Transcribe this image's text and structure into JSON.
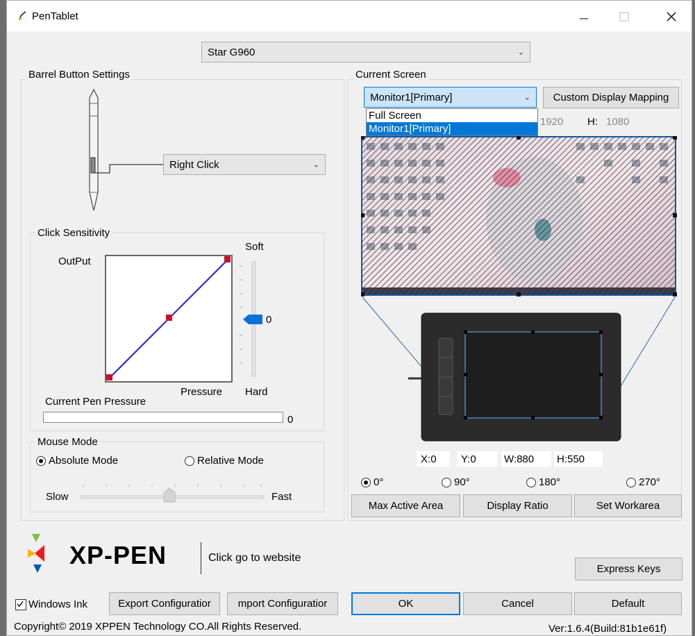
{
  "window": {
    "title": "PenTablet",
    "minimize_icon": "minimize-icon",
    "maximize_icon": "maximize-icon",
    "close_icon": "close-icon"
  },
  "device_select": {
    "value": "Star G960"
  },
  "barrel": {
    "group_label": "Barrel Button Settings",
    "button_action": "Right Click"
  },
  "click_sensitivity": {
    "group_label": "Click Sensitivity",
    "output_label": "OutPut",
    "pressure_label": "Pressure",
    "soft_label": "Soft",
    "hard_label": "Hard",
    "slider_value": "0",
    "current_pen_pressure_label": "Current Pen Pressure",
    "current_pen_pressure_value": "0"
  },
  "mouse_mode": {
    "group_label": "Mouse Mode",
    "absolute_label": "Absolute Mode",
    "relative_label": "Relative Mode",
    "selected": "absolute",
    "slow_label": "Slow",
    "fast_label": "Fast"
  },
  "current_screen": {
    "group_label": "Current Screen",
    "monitor_select": "Monitor1[Primary]",
    "dropdown_options": [
      "Full Screen",
      "Monitor1[Primary]"
    ],
    "custom_mapping_button": "Custom Display Mapping",
    "screen_w_partial": "1920",
    "screen_h_label": "H:",
    "screen_h_value": "1080"
  },
  "work_area": {
    "x_label": "X:",
    "x_value": "0",
    "y_label": "Y:",
    "y_value": "0",
    "w_label": "W:",
    "w_value": "880",
    "h_label": "H:",
    "h_value": "550"
  },
  "rotation": {
    "options": [
      "0°",
      "90°",
      "180°",
      "270°"
    ],
    "selected": "0°"
  },
  "area_buttons": {
    "max_active_area": "Max Active Area",
    "display_ratio": "Display Ratio",
    "set_workarea": "Set Workarea"
  },
  "brand": {
    "logo_text": "XP-PEN",
    "website_link": "Click go to website"
  },
  "express_keys_button": "Express Keys",
  "bottom": {
    "windows_ink_label": "Windows Ink",
    "windows_ink_checked": true,
    "export_button": "Export Configuratior",
    "import_button": "mport Configuratior",
    "ok_button": "OK",
    "cancel_button": "Cancel",
    "default_button": "Default",
    "copyright": "Copyright© 2019 XPPEN Technology CO.All Rights Reserved.",
    "version": "Ver:1.6.4(Build:81b1e61f)"
  },
  "colors": {
    "accent": "#0078d7",
    "curve": "#1a1ad8",
    "curve_point": "#c8102e",
    "slider_thumb": "#0a73d9"
  }
}
